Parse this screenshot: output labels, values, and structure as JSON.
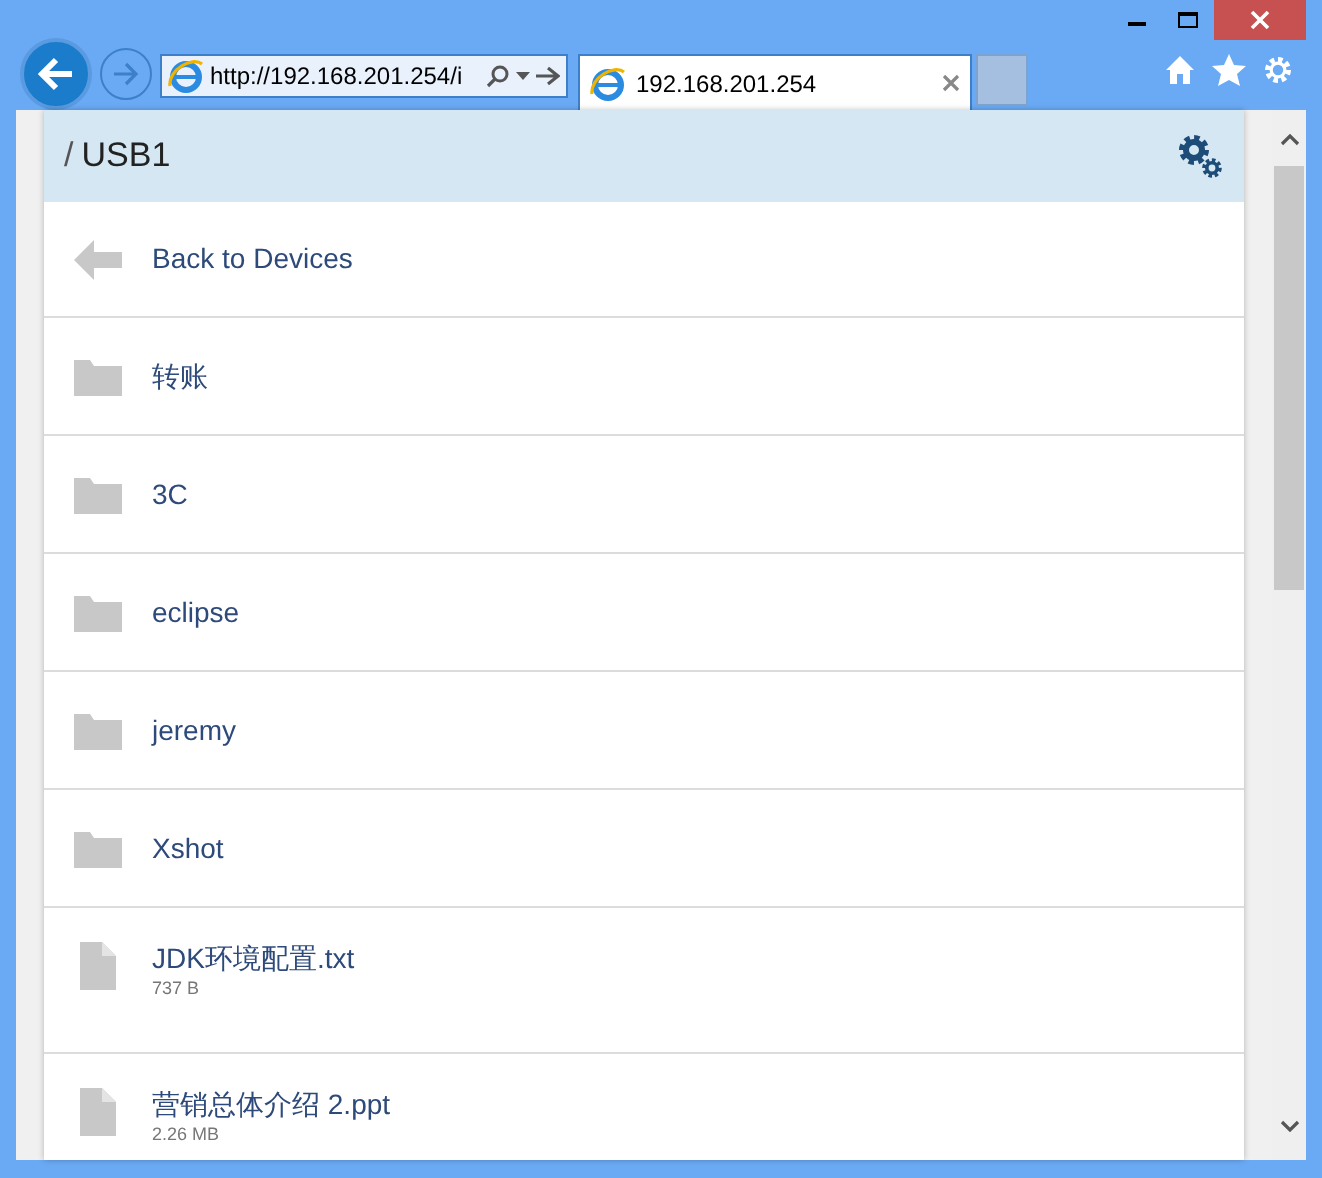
{
  "browser": {
    "address": "http://192.168.201.254/i",
    "tabs": [
      {
        "title": "192.168.201.254",
        "selected": true
      }
    ]
  },
  "breadcrumb": {
    "separator": "/",
    "current": "USB1"
  },
  "back": {
    "label": "Back to Devices"
  },
  "items": [
    {
      "kind": "folder",
      "name": "转账"
    },
    {
      "kind": "folder",
      "name": "3C"
    },
    {
      "kind": "folder",
      "name": "eclipse"
    },
    {
      "kind": "folder",
      "name": "jeremy"
    },
    {
      "kind": "folder",
      "name": "Xshot"
    },
    {
      "kind": "file",
      "name": "JDK环境配置.txt",
      "size": "737 B"
    },
    {
      "kind": "file",
      "name": "营销总体介绍 2.ppt",
      "size": "2.26 MB"
    }
  ]
}
